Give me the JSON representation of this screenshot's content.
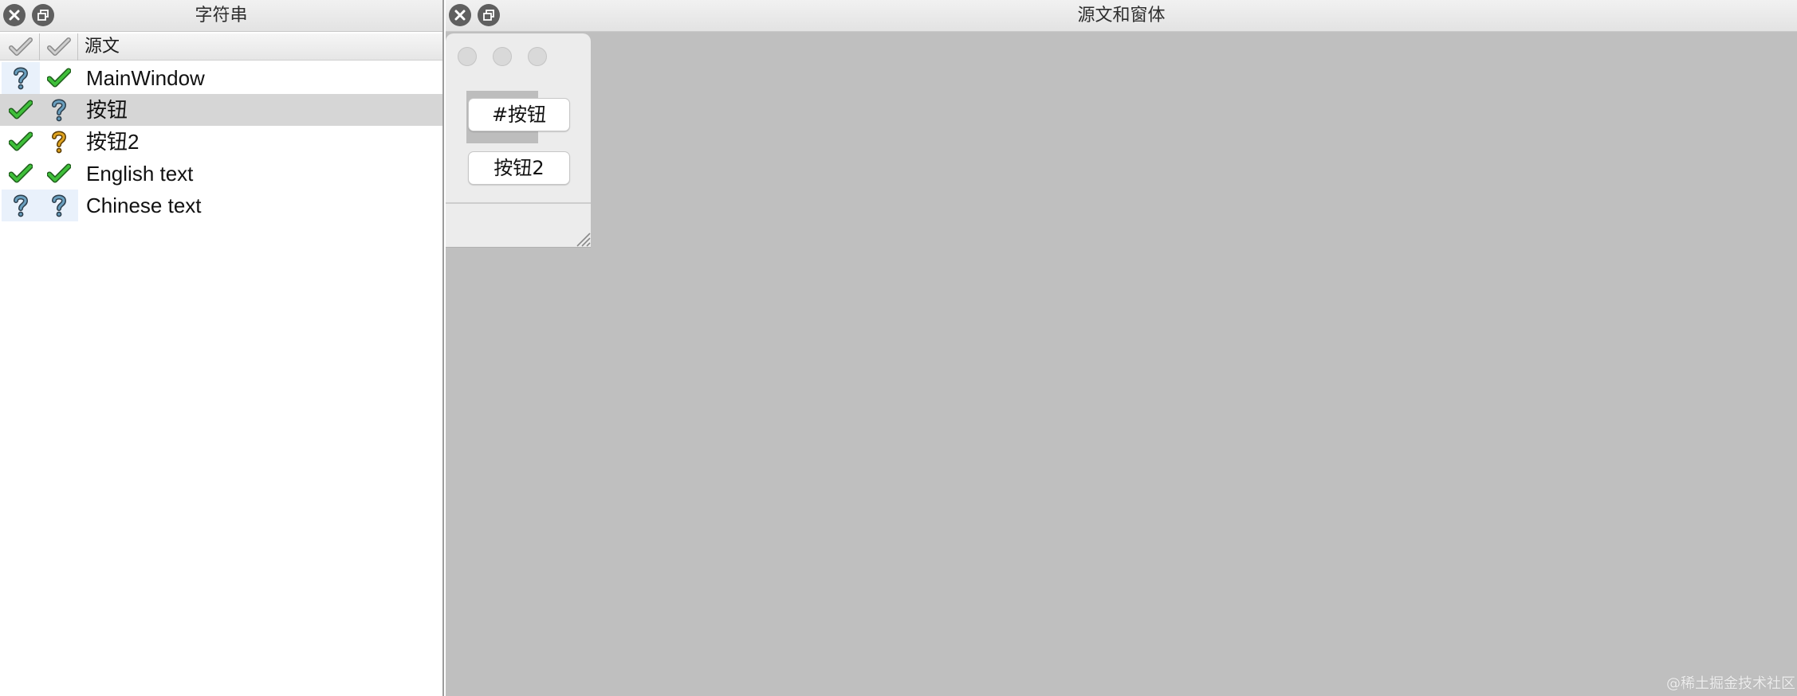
{
  "strings_dock": {
    "title": "字符串",
    "close_icon": "close-icon",
    "float_icon": "float-icon"
  },
  "table": {
    "header_label": "源文",
    "header_icons": [
      "check-gray-icon",
      "check-gray-icon"
    ],
    "rows": [
      {
        "text": "MainWindow",
        "status1": "question-blue",
        "status2": "check-green",
        "selected": false
      },
      {
        "text": "按钮",
        "status1": "check-green",
        "status2": "question-blue",
        "selected": true
      },
      {
        "text": "按钮2",
        "status1": "check-green",
        "status2": "question-yellow",
        "selected": false
      },
      {
        "text": "English text",
        "status1": "check-green",
        "status2": "check-green",
        "selected": false
      },
      {
        "text": "Chinese text",
        "status1": "question-blue",
        "status2": "question-blue",
        "selected": false
      }
    ]
  },
  "source_dock": {
    "title": "源文和窗体",
    "close_icon": "close-icon",
    "float_icon": "float-icon"
  },
  "form_preview": {
    "button1_label": "#按钮",
    "button2_label": "按钮2"
  },
  "watermark": "@稀土掘金技术社区",
  "colors": {
    "check_green": "#3fbf3a",
    "question_blue": "#6a9fbe",
    "question_yellow": "#e0a420",
    "selection": "#d6d6d6",
    "canvas_bg": "#bfbfbf"
  }
}
